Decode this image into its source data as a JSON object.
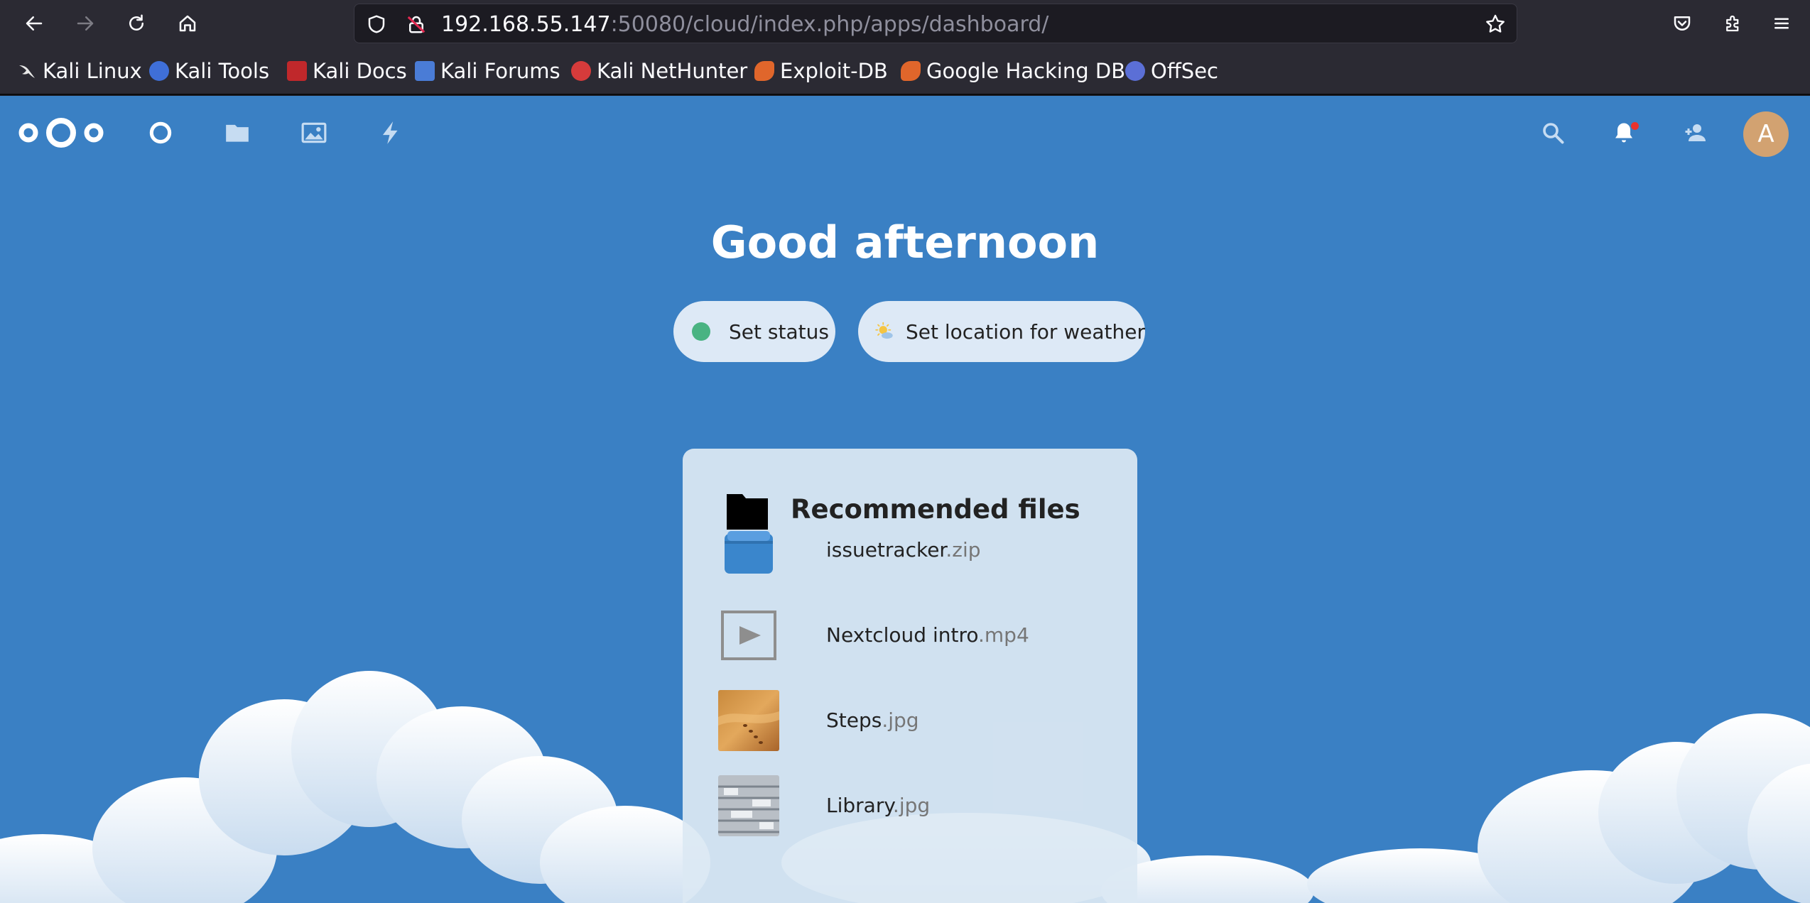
{
  "browser": {
    "url_host": "192.168.55.147",
    "url_rest": ":50080/cloud/index.php/apps/dashboard/",
    "bookmarks": [
      {
        "label": "Kali Linux",
        "icon": "kali-dragon-icon",
        "color": "#e8e8e8"
      },
      {
        "label": "Kali Tools",
        "icon": "kali-tools-icon",
        "color": "#3f6fd8"
      },
      {
        "label": "Kali Docs",
        "icon": "kali-docs-icon",
        "color": "#c0282b"
      },
      {
        "label": "Kali Forums",
        "icon": "kali-forums-icon",
        "color": "#4a7cd6"
      },
      {
        "label": "Kali NetHunter",
        "icon": "kali-nethunter-icon",
        "color": "#d63b3b"
      },
      {
        "label": "Exploit-DB",
        "icon": "exploit-db-icon",
        "color": "#e0662b"
      },
      {
        "label": "Google Hacking DB",
        "icon": "ghdb-icon",
        "color": "#e0662b"
      },
      {
        "label": "OffSec",
        "icon": "offsec-icon",
        "color": "#5b6fd6"
      }
    ]
  },
  "nextcloud": {
    "avatar_letter": "A",
    "greeting": "Good afternoon",
    "status_label": "Set status",
    "weather_label": "Set location for weather",
    "panel_title": "Recommended files",
    "files": [
      {
        "name": "issuetracker",
        "ext": ".zip",
        "icon": "archive-icon"
      },
      {
        "name": "Nextcloud intro",
        "ext": ".mp4",
        "icon": "video-icon"
      },
      {
        "name": "Steps",
        "ext": ".jpg",
        "icon": "image-thumbnail"
      },
      {
        "name": "Library",
        "ext": ".jpg",
        "icon": "image-thumbnail"
      }
    ],
    "colors": {
      "background": "#3a80c4",
      "status_online": "#49b382",
      "avatar": "#d2a271"
    }
  }
}
